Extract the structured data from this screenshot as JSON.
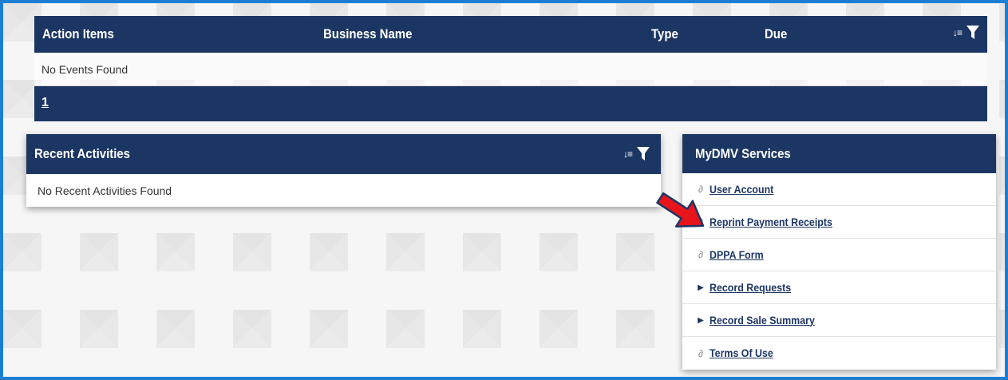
{
  "action_items": {
    "columns": [
      "Action Items",
      "Business Name",
      "Type",
      "Due"
    ],
    "empty_text": "No Events Found",
    "pager": {
      "current_page": "1"
    }
  },
  "recent_activities": {
    "title": "Recent Activities",
    "empty_text": "No Recent Activities Found"
  },
  "services": {
    "title": "MyDMV Services",
    "items": [
      {
        "label": "User Account",
        "icon": "link-icon"
      },
      {
        "label": "Reprint Payment Receipts",
        "icon": "link-icon"
      },
      {
        "label": "DPPA Form",
        "icon": "link-icon"
      },
      {
        "label": "Record Requests",
        "icon": "triangle-right-icon"
      },
      {
        "label": "Record Sale Summary",
        "icon": "triangle-right-icon"
      },
      {
        "label": "Terms Of Use",
        "icon": "link-icon"
      }
    ]
  },
  "icons": {
    "sort": "sort-descending-icon",
    "filter": "filter-icon",
    "annotation": "red-arrow-icon"
  },
  "colors": {
    "header_navy": "#1c3664",
    "frame_border": "#1a7fd4",
    "link": "#1c3664",
    "annotation_arrow": "#e8141b"
  }
}
